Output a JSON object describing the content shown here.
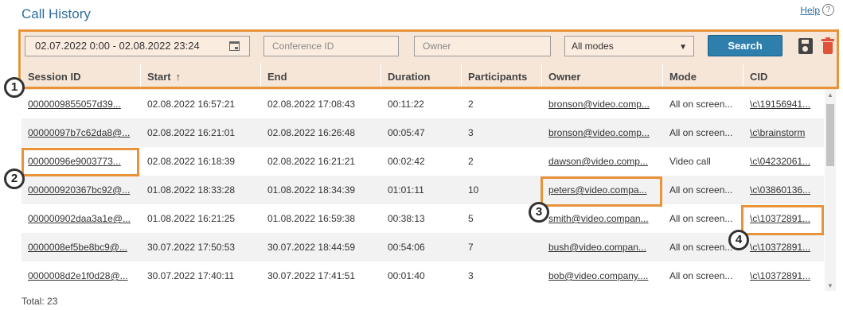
{
  "page": {
    "title": "Call History",
    "help_label": "Help",
    "help_icon": "question-circle-icon"
  },
  "filters": {
    "date_range": "02.07.2022 0:00 - 02.08.2022 23:24",
    "conference_placeholder": "Conference ID",
    "owner_placeholder": "Owner",
    "mode_selected": "All modes",
    "search_label": "Search"
  },
  "columns": [
    "Session ID",
    "Start",
    "End",
    "Duration",
    "Participants",
    "Owner",
    "Mode",
    "CID"
  ],
  "sort_indicator": "↑",
  "rows": [
    [
      "0000009855057d39...",
      "02.08.2022 16:57:21",
      "02.08.2022 17:08:43",
      "00:11:22",
      "2",
      "bronson@video.comp...",
      "All on screen...",
      "\\c\\19156941..."
    ],
    [
      "00000097b7c62da8@...",
      "02.08.2022 16:21:01",
      "02.08.2022 16:26:48",
      "00:05:47",
      "3",
      "bronson@video.comp...",
      "All on screen...",
      "\\c\\brainstorm"
    ],
    [
      "00000096e9003773...",
      "02.08.2022 16:18:39",
      "02.08.2022 16:21:21",
      "00:02:42",
      "2",
      "dawson@video.comp...",
      "Video call",
      "\\c\\04232061..."
    ],
    [
      "000000920367bc92@...",
      "01.08.2022 18:33:28",
      "01.08.2022 18:34:39",
      "01:01:11",
      "10",
      "peters@video.compa...",
      "All on screen...",
      "\\c\\03860136..."
    ],
    [
      "000000902daa3a1e@...",
      "01.08.2022 16:21:25",
      "01.08.2022 16:59:38",
      "00:38:13",
      "5",
      "smith@video.compan...",
      "All on screen...",
      "\\c\\10372891..."
    ],
    [
      "0000008ef5be8bc9@...",
      "30.07.2022 17:50:53",
      "30.07.2022 18:44:59",
      "00:54:06",
      "7",
      "bush@video.compan...",
      "All on screen...",
      "\\c\\10372891..."
    ],
    [
      "0000008d2e1f0d28@...",
      "30.07.2022 17:40:11",
      "30.07.2022 17:41:51",
      "00:01:40",
      "3",
      "bob@video.company....",
      "All on screen...",
      "\\c\\10372891..."
    ]
  ],
  "footer": {
    "total": "Total: 23"
  },
  "callouts": [
    "1",
    "2",
    "3",
    "4"
  ],
  "colors": {
    "accent": "#2e6e9e",
    "highlight": "#e8923a",
    "header_bg": "#f6e6d8",
    "button": "#2f7fad",
    "delete": "#e0533b"
  }
}
